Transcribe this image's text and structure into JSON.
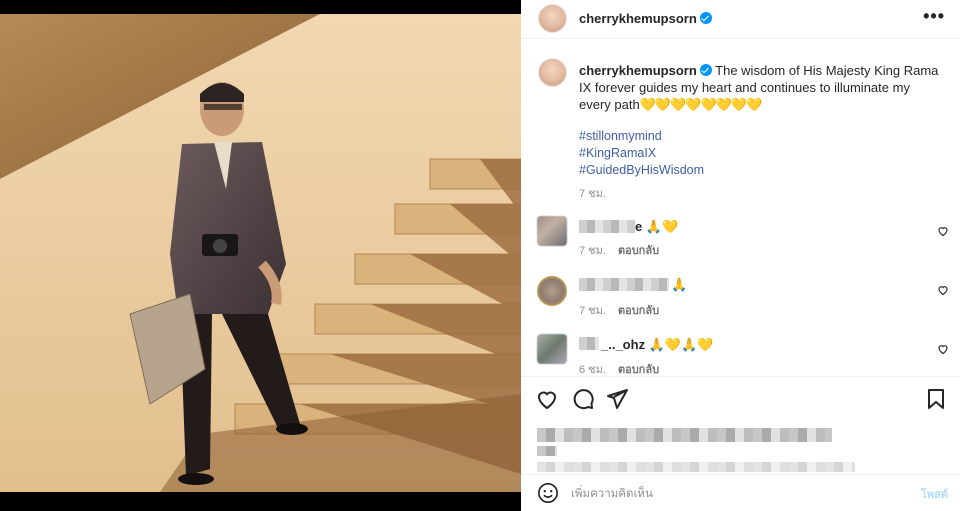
{
  "header": {
    "username": "cherrykhemupsorn",
    "more_label": "•••"
  },
  "caption": {
    "username": "cherrykhemupsorn",
    "text": "The wisdom of His Majesty King Rama IX forever guides my heart and continues to illuminate my every path",
    "emojis": "💛💛💛💛💛💛💛💛",
    "hashtags": [
      "#stillonmymind",
      "#KingRamaIX",
      "#GuidedByHisWisdom"
    ],
    "time": "7 ชม."
  },
  "comments": [
    {
      "username_visible": "e",
      "emojis": "🙏💛",
      "time": "7 ชม.",
      "reply_label": "ตอบกลับ"
    },
    {
      "username_visible": "",
      "emojis": "🙏",
      "time": "7 ชม.",
      "reply_label": "ตอบกลับ"
    },
    {
      "username_visible": "_.._ohz",
      "emojis": "🙏💛🙏💛",
      "time": "6 ชม.",
      "reply_label": "ตอบกลับ"
    }
  ],
  "add_comment": {
    "placeholder": "เพิ่มความคิดเห็น",
    "post_label": "โพสต์"
  },
  "colors": {
    "link": "#3f5ea8",
    "verified": "#0095f6",
    "post_button": "#b3dbff"
  },
  "icons": [
    "verified-icon",
    "more-options-icon",
    "heart-icon",
    "comment-icon",
    "share-icon",
    "bookmark-icon",
    "emoji-icon"
  ]
}
